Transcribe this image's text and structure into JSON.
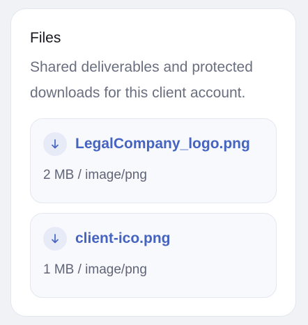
{
  "panel": {
    "title": "Files",
    "description": "Shared deliverables and protected downloads for this client account."
  },
  "files": [
    {
      "name": "LegalCompany_logo.png",
      "meta": "2 MB / image/png",
      "icon": "download-arrow-icon"
    },
    {
      "name": "client-ico.png",
      "meta": "1 MB / image/png",
      "icon": "download-arrow-icon"
    }
  ],
  "colors": {
    "accent": "#4563c0",
    "icon_bg": "#e7eaf7"
  }
}
